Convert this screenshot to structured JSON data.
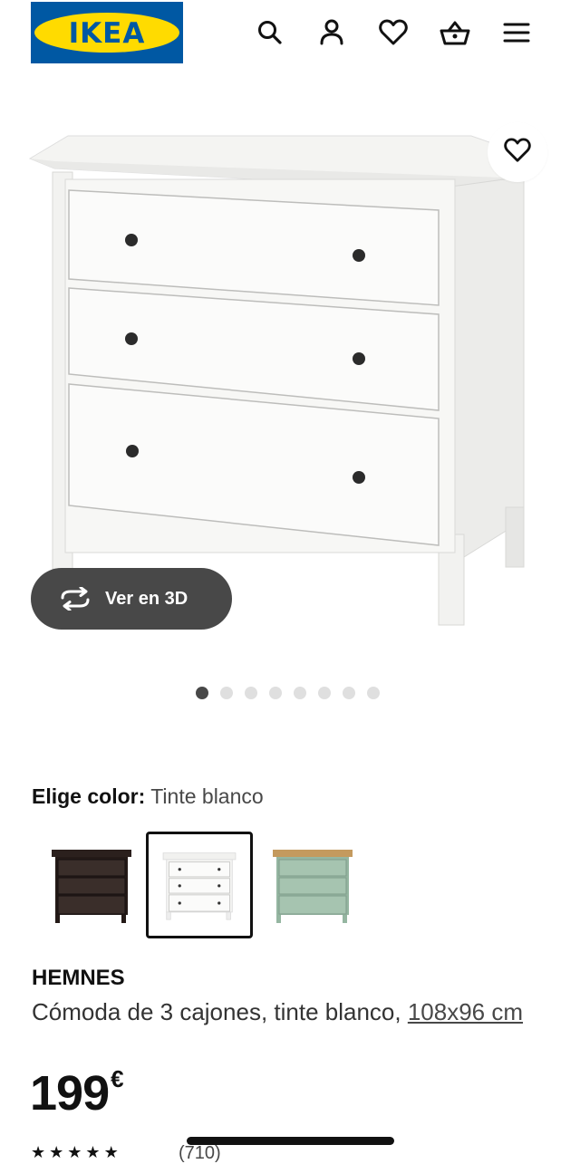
{
  "header": {
    "logo_text": "IKEA",
    "icons": [
      "search-icon",
      "user-icon",
      "heart-icon",
      "basket-icon",
      "menu-icon"
    ]
  },
  "gallery": {
    "view3d_label": "Ver en 3D",
    "dots_total": 8,
    "active_dot": 1
  },
  "color": {
    "label": "Elige color:",
    "value": "Tinte blanco",
    "swatches": [
      {
        "name": "dark-brown",
        "color": "#2b201d"
      },
      {
        "name": "white",
        "color": "#ffffff",
        "selected": true
      },
      {
        "name": "green",
        "color": "#9fbfaa"
      }
    ]
  },
  "product": {
    "name": "HEMNES",
    "desc_prefix": "Cómoda de 3 cajones, tinte blanco, ",
    "size": "108x96 cm",
    "price": "199",
    "currency": "€",
    "reviews": "(710)"
  },
  "colors": {
    "ikea_blue": "#0058a3",
    "ikea_yellow": "#ffdb00",
    "button_dark": "#484848"
  }
}
